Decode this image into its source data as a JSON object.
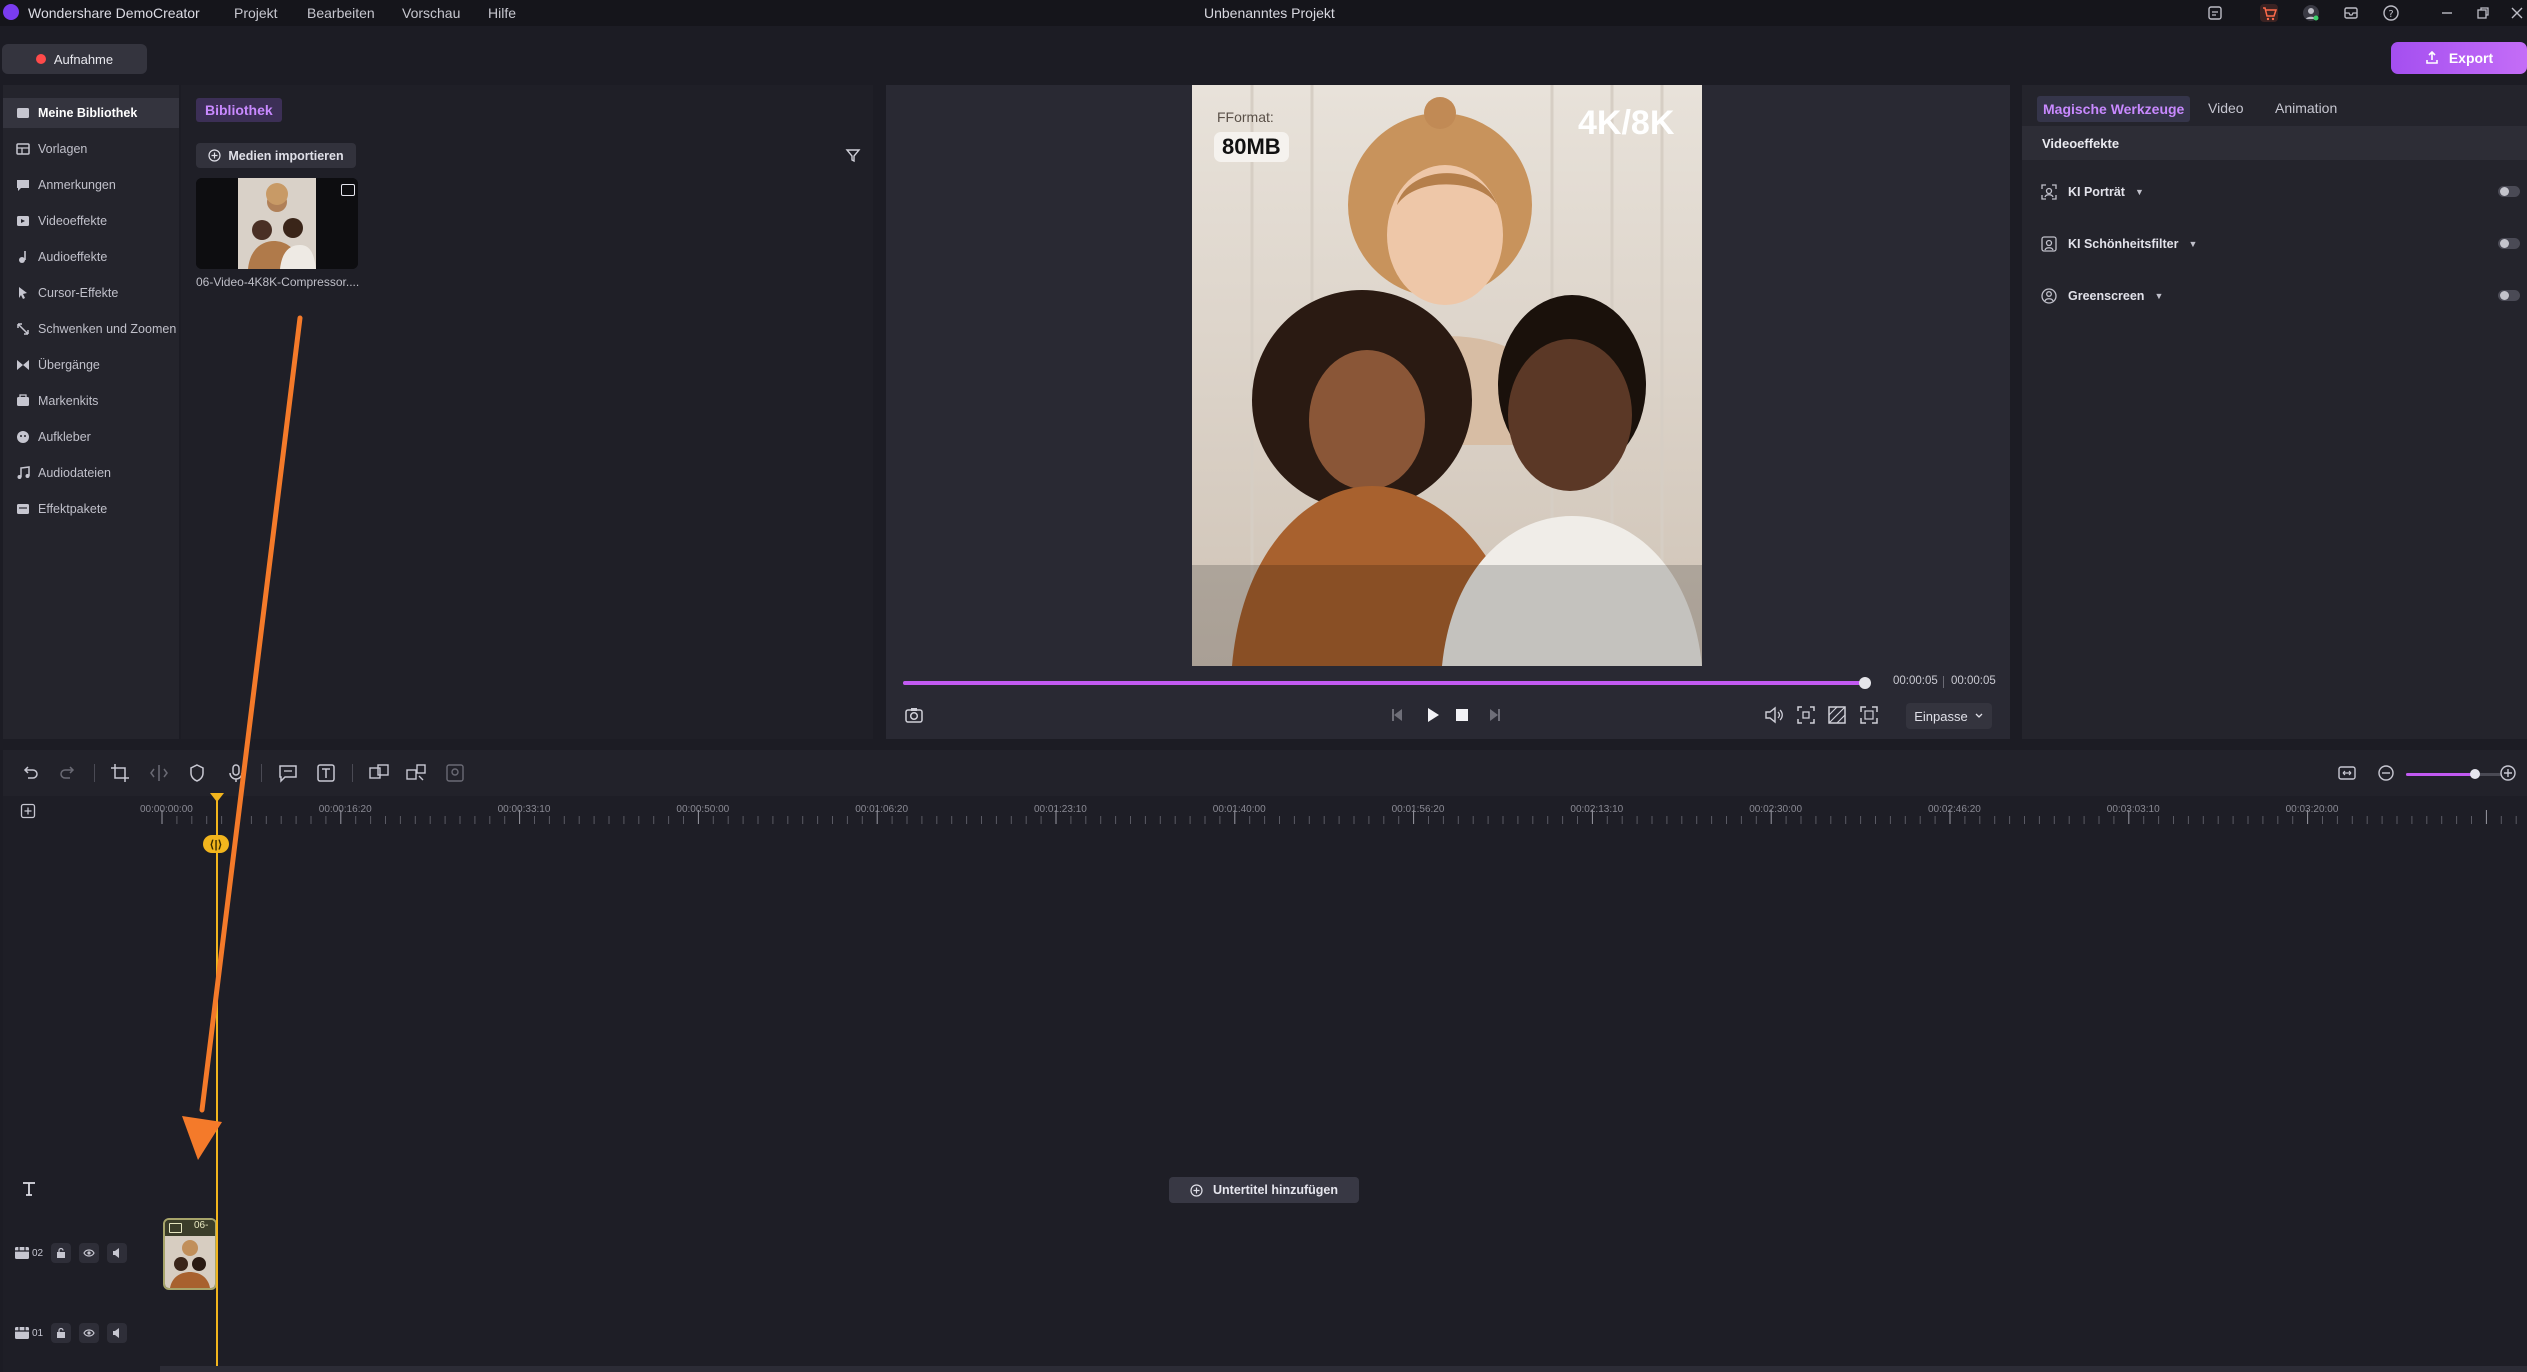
{
  "app": {
    "name": "Wondershare DemoCreator",
    "project_title": "Unbenanntes Projekt",
    "menu": [
      "Projekt",
      "Bearbeiten",
      "Vorschau",
      "Hilfe"
    ]
  },
  "toolbar": {
    "record_label": "Aufnahme",
    "export_label": "Export"
  },
  "sidebar": {
    "items": [
      {
        "label": "Meine Bibliothek",
        "icon": "library-icon",
        "active": true
      },
      {
        "label": "Vorlagen",
        "icon": "templates-icon"
      },
      {
        "label": "Anmerkungen",
        "icon": "annotations-icon"
      },
      {
        "label": "Videoeffekte",
        "icon": "video-effects-icon"
      },
      {
        "label": "Audioeffekte",
        "icon": "audio-effects-icon"
      },
      {
        "label": "Cursor-Effekte",
        "icon": "cursor-effects-icon"
      },
      {
        "label": "Schwenken und Zoomen",
        "icon": "pan-zoom-icon"
      },
      {
        "label": "Übergänge",
        "icon": "transitions-icon"
      },
      {
        "label": "Markenkits",
        "icon": "brand-kits-icon"
      },
      {
        "label": "Aufkleber",
        "icon": "stickers-icon"
      },
      {
        "label": "Audiodateien",
        "icon": "audio-files-icon"
      },
      {
        "label": "Effektpakete",
        "icon": "effect-packs-icon"
      }
    ]
  },
  "library": {
    "title": "Bibliothek",
    "import_label": "Medien importieren",
    "media": [
      {
        "name": "06-Video-4K8K-Compressor...."
      }
    ]
  },
  "preview": {
    "overlay_format": "FFormat:",
    "overlay_size": "80MB",
    "overlay_resolution": "4K/8K",
    "current_time": "00:00:05",
    "total_time": "00:00:05",
    "progress_fraction": 0.996,
    "fit_label": "Einpasse"
  },
  "right_panel": {
    "tabs": [
      "Magische Werkzeuge",
      "Video",
      "Animation"
    ],
    "active_tab": "Magische Werkzeuge",
    "section_title": "Videoeffekte",
    "effects": [
      {
        "label": "KI Porträt",
        "enabled": false
      },
      {
        "label": "KI Schönheitsfilter",
        "enabled": false
      },
      {
        "label": "Greenscreen",
        "enabled": false
      }
    ]
  },
  "timeline": {
    "ruler_labels": [
      "00:00:00:00",
      "00:00:16:20",
      "00:00:33:10",
      "00:00:50:00",
      "00:01:06:20",
      "00:01:23:10",
      "00:01:40:00",
      "00:01:56:20",
      "00:02:13:10",
      "00:02:30:00",
      "00:02:46:20",
      "00:03:03:10",
      "00:03:20:00"
    ],
    "add_subtitle_label": "Untertitel hinzufügen",
    "tracks": [
      {
        "number": "02"
      },
      {
        "number": "01"
      }
    ],
    "clip_label": "06-",
    "zoom_fraction": 0.72
  },
  "colors": {
    "accent": "#c25af2",
    "playhead": "#f2b51d",
    "annotation_arrow": "#f47a2a"
  }
}
